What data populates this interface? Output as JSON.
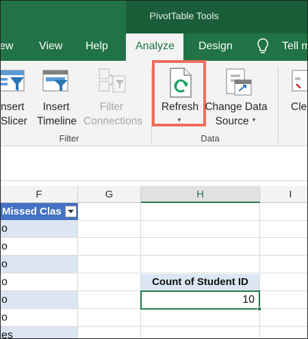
{
  "context_title": "PivotTable Tools",
  "tabs": {
    "view_partial": "ew",
    "view": "View",
    "help": "Help",
    "analyze": "Analyze",
    "design": "Design",
    "tell_me_partial": "Tell m"
  },
  "ribbon": {
    "insert_slicer": [
      "nsert",
      "Slicer"
    ],
    "insert_timeline": [
      "Insert",
      "Timeline"
    ],
    "filter_connections": [
      "Filter",
      "Connections"
    ],
    "refresh": "Refresh",
    "change_data_source": [
      "Change Data",
      "Source"
    ],
    "clear_partial": "Cle",
    "groups": {
      "filter": "Filter",
      "data": "Data"
    }
  },
  "sheet": {
    "columns": [
      "F",
      "G",
      "H",
      "I"
    ],
    "f_header": "Missed Clas",
    "f_values": [
      "o",
      "o",
      "o",
      "o",
      "o",
      "o",
      "es"
    ],
    "pivot_header": "Count of Student ID",
    "pivot_value": "10"
  },
  "colors": {
    "excel_green": "#217346",
    "highlight_red": "#ef6b5b",
    "table_header_blue": "#4472c4",
    "banded_row": "#dbe5f3"
  }
}
